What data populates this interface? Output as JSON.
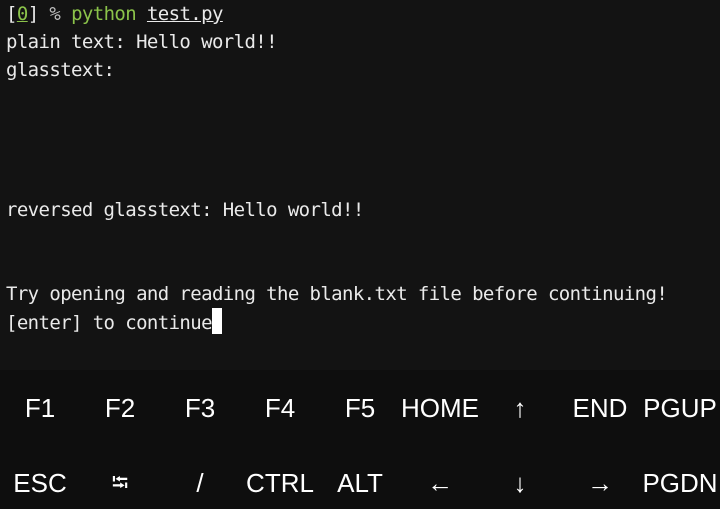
{
  "terminal": {
    "prompt": {
      "bracket_open": "[",
      "status": "0",
      "bracket_close": "]",
      "symbol": "%",
      "command": "python",
      "file": "test.py"
    },
    "lines": [
      "plain text: Hello world!!",
      "glasstext:",
      "reversed glasstext: Hello world!!",
      "Try opening and reading the blank.txt file before continuing!",
      "[enter] to continue"
    ]
  },
  "keyboard": {
    "row1": [
      "F1",
      "F2",
      "F3",
      "F4",
      "F5",
      "HOME",
      "↑",
      "END",
      "PGUP"
    ],
    "row2": [
      "ESC",
      "⭾",
      "/",
      "CTRL",
      "ALT",
      "←",
      "↓",
      "→",
      "PGDN"
    ]
  },
  "colors": {
    "background": "#131313",
    "text": "#eaeaea",
    "prompt_green": "#8bc34a",
    "cursor": "#ffffff"
  }
}
